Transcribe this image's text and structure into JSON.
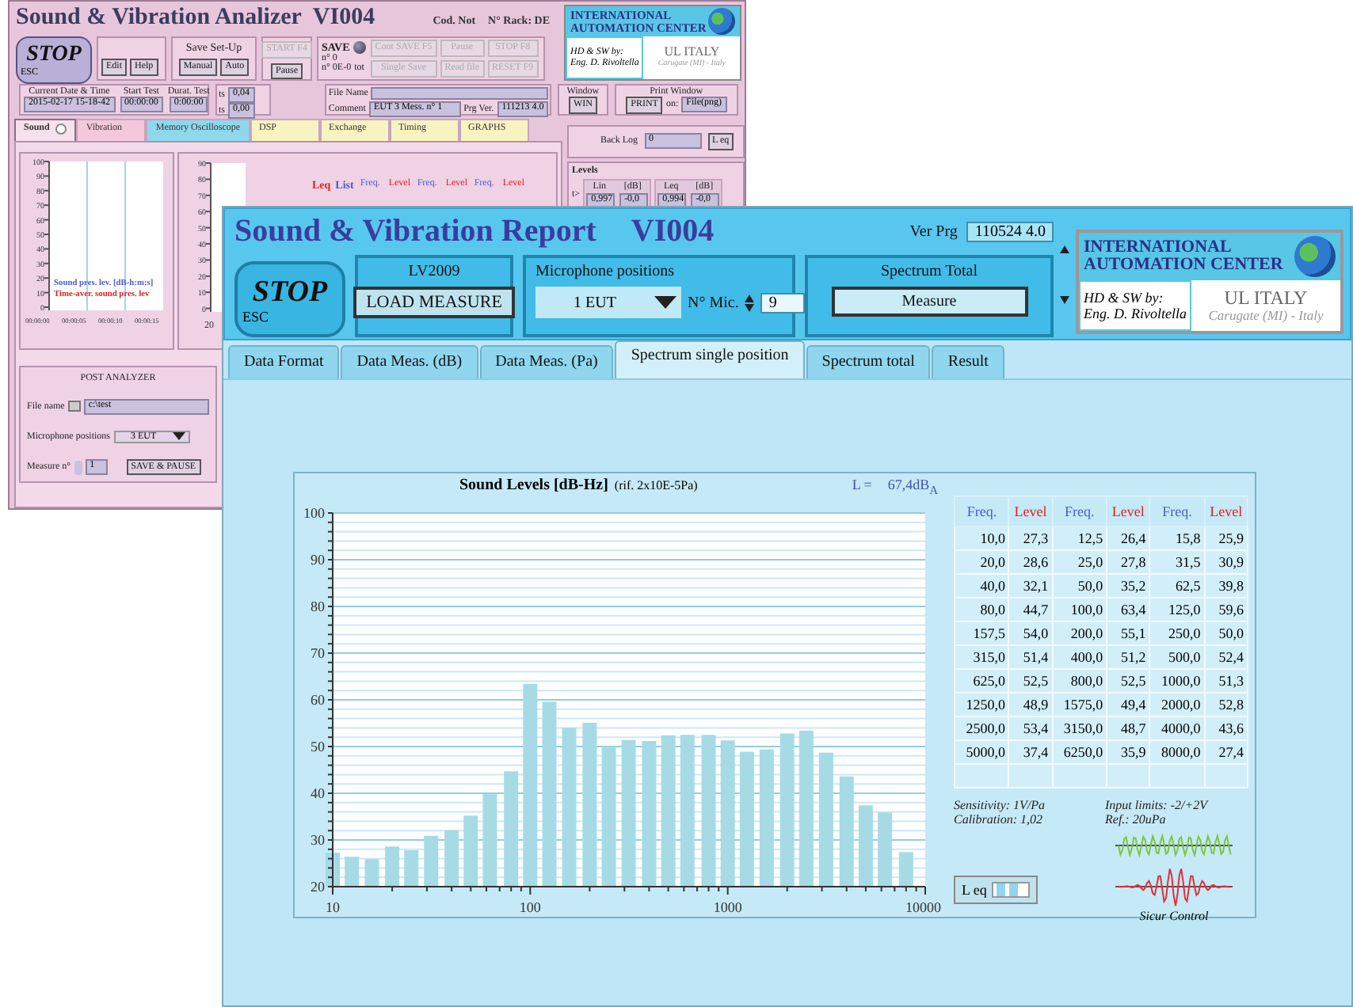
{
  "back_window": {
    "title": "Sound & Vibration Analizer  VI004",
    "cod": "Cod. Not",
    "rack": "N° Rack: DE",
    "stop": {
      "label": "STOP",
      "key": "ESC"
    },
    "edit_buttons": [
      "Edit",
      "Help"
    ],
    "save_setup": {
      "title": "Save Set-Up",
      "buttons": [
        "Manual",
        "Auto"
      ]
    },
    "start_buttons": [
      {
        "label": "START F4",
        "disabled": true
      },
      {
        "label": "Pause",
        "disabled": false
      }
    ],
    "save_panel": {
      "label": "SAVE",
      "count_1": "n° 0",
      "count_2": "n° 0E-0",
      "count_unit": "tot",
      "buttons": [
        {
          "label": "Cont SAVE F5",
          "disabled": true
        },
        {
          "label": "Pause",
          "disabled": true
        },
        {
          "label": "STOP F8",
          "disabled": true
        },
        {
          "label": "Single Save",
          "disabled": true
        },
        {
          "label": "Read file",
          "disabled": true
        },
        {
          "label": "RESET F9",
          "disabled": true
        }
      ]
    },
    "logo": {
      "line_1": "INTERNATIONAL",
      "line_2": "AUTOMATION CENTER",
      "credit_1": "HD & SW by:",
      "credit_2": "Eng. D. Rivoltella",
      "company": "UL ITALY",
      "place": "Carugate (MI) - Italy"
    },
    "date": {
      "label": "Current Date & Time",
      "value": "2015-02-17 15-18-42"
    },
    "start_test": {
      "label": "Start Test",
      "value": "00:00:00"
    },
    "duration": {
      "label": "Durat. Test",
      "value": "0:00:00"
    },
    "ts": [
      {
        "label": "ts",
        "value": "0,04"
      },
      {
        "label": "ts",
        "value": "0,00"
      }
    ],
    "file_name_label": "File Name",
    "comment_label": "Comment",
    "comment": "EUT 3 Mess. n° 1",
    "prg_ver_label": "Prg Ver.",
    "prg_ver": "111213 4.0",
    "window": {
      "label": "Window",
      "button": "WIN"
    },
    "print_window": {
      "label": "Print Window",
      "button": "PRINT",
      "on_label": "on:",
      "target": "File(png)"
    },
    "tabs": [
      {
        "label": "Sound",
        "selected": true,
        "color": "#f7e1ee"
      },
      {
        "label": "Vibration",
        "selected": false,
        "color": "#f4c8dc"
      },
      {
        "label": "Memory Oscilloscope",
        "selected": false,
        "color": "#8fd8ec"
      },
      {
        "label": "DSP",
        "selected": false,
        "color": "#f8f3c0"
      },
      {
        "label": "Exchange",
        "selected": false,
        "color": "#f8f3c0"
      },
      {
        "label": "Timing",
        "selected": false,
        "color": "#f8f3c0"
      },
      {
        "label": "GRAPHS",
        "selected": false,
        "color": "#f8f3c0"
      }
    ],
    "back_log": {
      "label": "Back Log",
      "value": "0",
      "button": "L eq"
    },
    "levels": {
      "title": "Levels",
      "row_label": "t>",
      "columns": [
        {
          "label": "Lin",
          "unit": "[dB]",
          "value": "0,997",
          "db": "-0,0"
        },
        {
          "label": "Leq",
          "unit": "[dB]",
          "value": "0,994",
          "db": "-0,0"
        }
      ]
    },
    "time_chart": {
      "yticks": [
        "100",
        "90",
        "80",
        "70",
        "60",
        "50",
        "40",
        "30",
        "20",
        "10",
        "0"
      ],
      "xticks": [
        "00:00:00",
        "00:00:05",
        "00:00:10",
        "00:00:15"
      ],
      "legend": [
        {
          "text": "Sound pres. lev. [dB-h:m:s]",
          "color": "#4a5bd0"
        },
        {
          "text": "Time-aver. sound pres. lev",
          "color": "#e02020"
        }
      ]
    },
    "spectrum_chart": {
      "yticks": [
        "90",
        "80",
        "70",
        "60",
        "50",
        "40",
        "30",
        "20",
        "10",
        "0"
      ],
      "xtick": "20",
      "legend": [
        {
          "text": "Leq",
          "color": "#e02020"
        },
        {
          "text": "List",
          "color": "#4a5bd0"
        }
      ]
    },
    "table_headers": [
      "Freq.",
      "Level",
      "Freq.",
      "Level",
      "Freq.",
      "Level"
    ],
    "post_analyzer": {
      "title": "POST ANALYZER",
      "file_label": "File name",
      "file_value": "c:\\test",
      "mic_label": "Microphone positions",
      "mic_value": "3 EUT",
      "measure_label": "Measure n°",
      "measure_value": "1",
      "button": "SAVE & PAUSE"
    }
  },
  "front_window": {
    "title": "Sound & Vibration Report",
    "code": "VI004",
    "ver_label": "Ver Prg",
    "ver": "110524 4.0",
    "stop": {
      "label": "STOP",
      "key": "ESC"
    },
    "measure_panel": {
      "title": "LV2009",
      "button": "LOAD MEASURE"
    },
    "mic_panel": {
      "label": "Microphone positions",
      "value": "1 EUT",
      "mic_label": "N° Mic.",
      "mic_count": "9"
    },
    "spectrum_panel": {
      "title": "Spectrum Total",
      "button": "Measure"
    },
    "logo": {
      "line_1": "INTERNATIONAL",
      "line_2": "AUTOMATION CENTER",
      "credit_1": "HD & SW by:",
      "credit_2": "Eng. D. Rivoltella",
      "company": "UL ITALY",
      "place": "Carugate (MI) - Italy"
    },
    "tabs": [
      {
        "label": "Data Format",
        "selected": false
      },
      {
        "label": "Data Meas. (dB)",
        "selected": false
      },
      {
        "label": "Data Meas. (Pa)",
        "selected": false
      },
      {
        "label": "Spectrum single position",
        "selected": true
      },
      {
        "label": "Spectrum total",
        "selected": false
      },
      {
        "label": "Result",
        "selected": false
      }
    ],
    "chart_panel": {
      "subtitle": "(rif. 2x10E-5Pa)",
      "total_label": "L =",
      "total_value": "67,4dB$_{A}$",
      "chart_data": {
        "type": "bar",
        "title": "Sound Levels [dB-Hz]",
        "grid": true,
        "values": [
          27.3,
          26.4,
          25.9,
          28.6,
          27.8,
          30.9,
          32.1,
          35.2,
          39.8,
          44.7,
          63.4,
          59.6,
          54.0,
          55.1,
          50.0,
          51.4,
          51.2,
          52.4,
          52.5,
          52.5,
          51.3,
          48.9,
          49.4,
          52.8,
          53.4,
          48.7,
          43.6,
          37.4,
          35.9,
          27.4
        ],
        "ylim": [
          20,
          100
        ],
        "yticks": [
          20,
          30,
          40,
          50,
          60,
          70,
          80,
          90,
          100
        ]
      },
      "x_axis_labels": [
        "10",
        "100",
        "1000",
        "10000"
      ],
      "table": {
        "headers": [
          "Freq.",
          "Level",
          "Freq.",
          "Level",
          "Freq.",
          "Level"
        ],
        "rows": [
          [
            "10,0",
            "27,3",
            "12,5",
            "26,4",
            "15,8",
            "25,9"
          ],
          [
            "20,0",
            "28,6",
            "25,0",
            "27,8",
            "31,5",
            "30,9"
          ],
          [
            "40,0",
            "32,1",
            "50,0",
            "35,2",
            "62,5",
            "39,8"
          ],
          [
            "80,0",
            "44,7",
            "100,0",
            "63,4",
            "125,0",
            "59,6"
          ],
          [
            "157,5",
            "54,0",
            "200,0",
            "55,1",
            "250,0",
            "50,0"
          ],
          [
            "315,0",
            "51,4",
            "400,0",
            "51,2",
            "500,0",
            "52,4"
          ],
          [
            "625,0",
            "52,5",
            "800,0",
            "52,5",
            "1000,0",
            "51,3"
          ],
          [
            "1250,0",
            "48,9",
            "1575,0",
            "49,4",
            "2000,0",
            "52,8"
          ],
          [
            "2500,0",
            "53,4",
            "3150,0",
            "48,7",
            "4000,0",
            "43,6"
          ],
          [
            "5000,0",
            "37,4",
            "6250,0",
            "35,9",
            "8000,0",
            "27,4"
          ]
        ]
      },
      "notes": [
        "Sensitivity: 1V/Pa",
        "Input limits: -2/+2V",
        "Calibration: 1,02",
        "Ref.: 20uPa"
      ],
      "leq_button": "L eq",
      "brand": "Sicur Control"
    }
  }
}
